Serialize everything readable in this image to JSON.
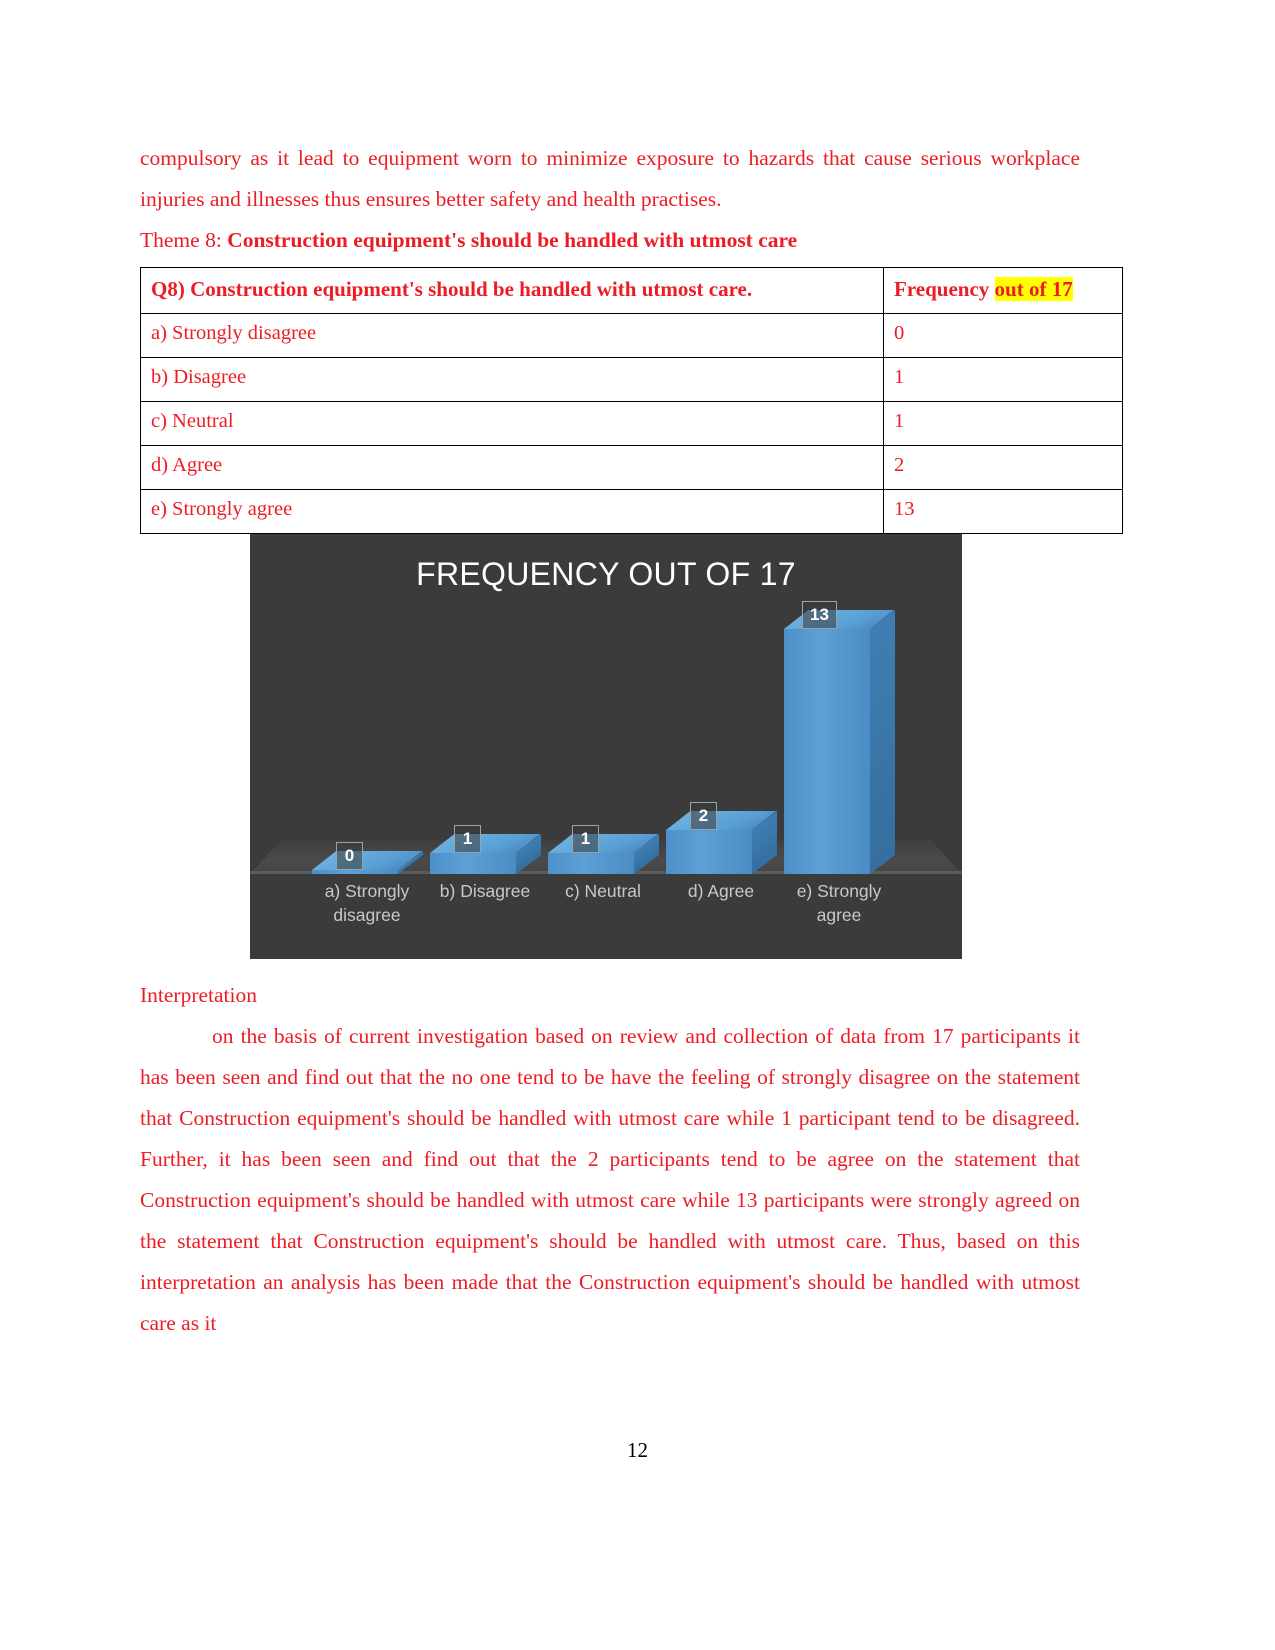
{
  "document": {
    "page_number": "12",
    "text_color": "#ed1c24",
    "highlight_color": "#ffff00"
  },
  "intro": {
    "paragraph": "compulsory as it lead to equipment worn to minimize exposure to hazards that cause serious workplace injuries and illnesses thus ensures better safety and health practises."
  },
  "theme": {
    "prefix": "Theme 8: ",
    "title": "Construction equipment's should be handled with utmost care"
  },
  "table": {
    "header": {
      "question": "Q8) Construction equipment's should be handled with utmost care.",
      "frequency_plain": "Frequency ",
      "frequency_highlight": "out of 17"
    },
    "rows": [
      {
        "option": "a) Strongly disagree",
        "frequency": "0"
      },
      {
        "option": "b) Disagree",
        "frequency": "1"
      },
      {
        "option": "c) Neutral",
        "frequency": "1"
      },
      {
        "option": "d) Agree",
        "frequency": "2"
      },
      {
        "option": "e) Strongly agree",
        "frequency": "13"
      }
    ]
  },
  "chart_data": {
    "type": "bar",
    "title": "FREQUENCY OUT OF 17",
    "categories": [
      "a) Strongly disagree",
      "b) Disagree",
      "c) Neutral",
      "d) Agree",
      "e) Strongly agree"
    ],
    "category_lines": [
      [
        "a) Strongly",
        "disagree"
      ],
      [
        "b) Disagree",
        ""
      ],
      [
        "c) Neutral",
        ""
      ],
      [
        "d) Agree",
        ""
      ],
      [
        "e) Strongly",
        "agree"
      ]
    ],
    "values": [
      0,
      1,
      1,
      2,
      13
    ],
    "data_labels": [
      "0",
      "1",
      "1",
      "2",
      "13"
    ],
    "xlabel": "",
    "ylabel": "",
    "ylim": [
      0,
      13
    ],
    "grid": false,
    "legend": false,
    "style": "3d-column",
    "background_color": "#3b3b3b",
    "bar_color": "#5ba0d6",
    "title_color": "#ffffff",
    "axis_label_color": "#c8c8c8"
  },
  "interpretation": {
    "heading": "Interpretation",
    "body": "on the basis of current investigation based on review and collection of data from 17 participants it has been seen and find out that the no one tend to be have the feeling of strongly disagree on the statement that Construction equipment's should be handled with utmost care while 1 participant tend to be disagreed. Further, it has been seen and find out that the 2 participants tend to be agree on the statement that Construction equipment's should be handled with utmost care while 13 participants were strongly agreed on the statement that Construction equipment's should be handled with utmost care. Thus, based on this interpretation an analysis has been made that the Construction equipment's should be handled with utmost care as it"
  }
}
